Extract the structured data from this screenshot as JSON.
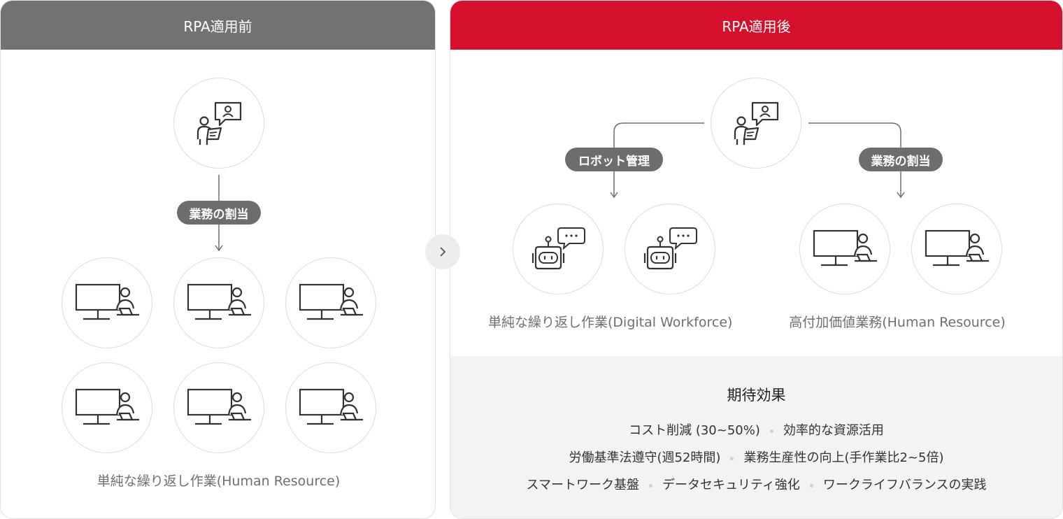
{
  "before": {
    "header": "RPA適用前",
    "pill": "業務の割当",
    "caption": "単純な繰り返し作業(Human Resource)"
  },
  "after": {
    "header": "RPA適用後",
    "pill_left": "ロボット管理",
    "pill_right": "業務の割当",
    "caption_left": "単純な繰り返し作業(Digital Workforce)",
    "caption_right": "高付加価値業務(Human Resource)"
  },
  "effects": {
    "title": "期待効果",
    "rows": [
      [
        "コスト削減 (30~50%)",
        "効率的な資源活用"
      ],
      [
        "労働基準法遵守(週52時間)",
        "業務生産性の向上(手作業比2~5倍)"
      ],
      [
        "スマートワーク基盤",
        "データセキュリティ強化",
        "ワークライフバランスの実践"
      ]
    ]
  },
  "colors": {
    "before_header": "#737272",
    "after_header": "#d5102d",
    "pill": "#6e6d6d",
    "effects_bg": "#f3f3f3"
  },
  "icons": {
    "manager": "manager-presenting-icon",
    "worker": "worker-at-computer-icon",
    "robot": "robot-chat-icon",
    "next": "chevron-right-icon"
  }
}
